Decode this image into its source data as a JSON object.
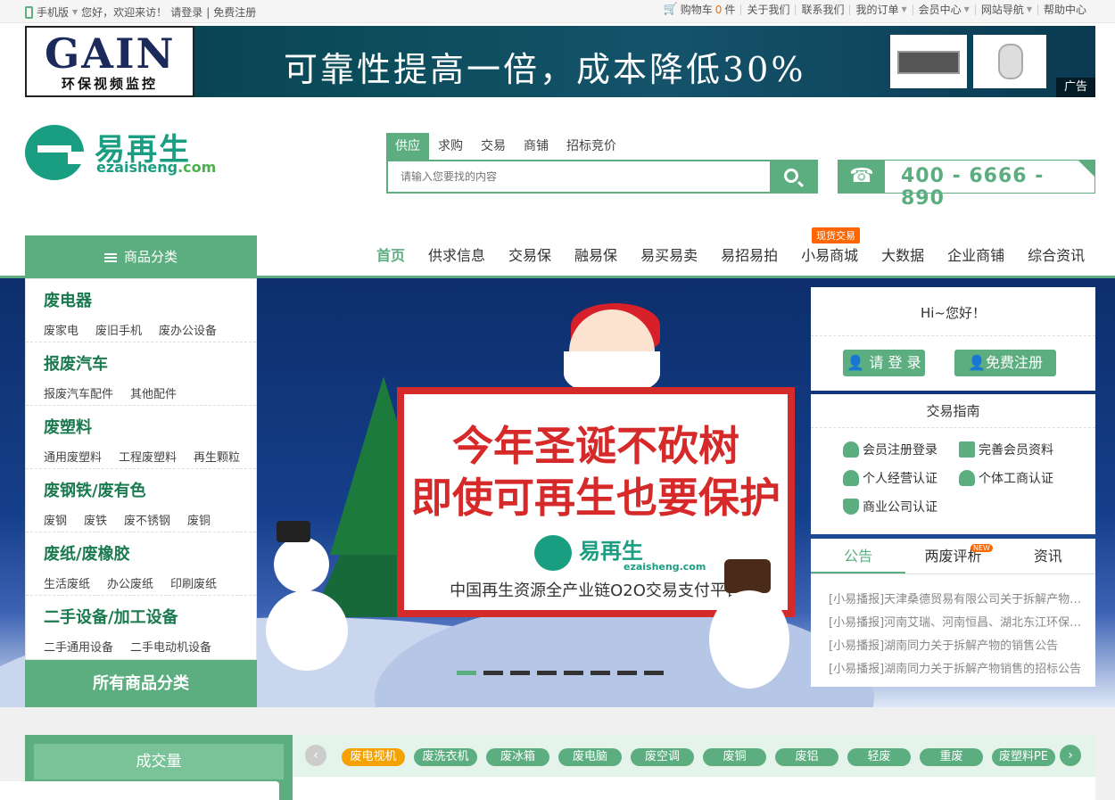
{
  "topbar": {
    "mobile": "手机版",
    "greeting": "您好，欢迎来访！",
    "login": "请登录",
    "divider": "|",
    "register": "免费注册",
    "cart_label": "购物车",
    "cart_count": "0",
    "cart_unit": "件",
    "links": [
      "关于我们",
      "联系我们",
      "我的订单",
      "会员中心",
      "网站导航",
      "帮助中心"
    ]
  },
  "ad": {
    "logo_text": "GAIN",
    "logo_sub": "环保视频监控",
    "slogan": "可靠性提高一倍，成本降低30%",
    "tag": "广告"
  },
  "brand": {
    "cn": "易再生",
    "en_main": "ezaisheng",
    "en_tld": ".com"
  },
  "search": {
    "tabs": [
      "供应",
      "求购",
      "交易",
      "商铺",
      "招标竞价"
    ],
    "active_tab": "供应",
    "placeholder": "请输入您要找的内容"
  },
  "hotline": {
    "number": "400 - 6666 - 890"
  },
  "nav": {
    "category_label": "商品分类",
    "items": [
      "首页",
      "供求信息",
      "交易保",
      "融易保",
      "易买易卖",
      "易招易拍",
      "小易商城",
      "大数据",
      "企业商铺",
      "综合资讯"
    ],
    "active": "首页",
    "badge": "现货交易"
  },
  "categories": [
    {
      "title": "废电器",
      "subs": [
        "废家电",
        "废旧手机",
        "废办公设备"
      ]
    },
    {
      "title": "报废汽车",
      "subs": [
        "报废汽车配件",
        "其他配件"
      ]
    },
    {
      "title": "废塑料",
      "subs": [
        "通用废塑料",
        "工程废塑料",
        "再生颗粒"
      ]
    },
    {
      "title": "废钢铁/废有色",
      "subs": [
        "废钢",
        "废铁",
        "废不锈钢",
        "废铜"
      ]
    },
    {
      "title": "废纸/废橡胶",
      "subs": [
        "生活废纸",
        "办公废纸",
        "印刷废纸"
      ]
    },
    {
      "title": "二手设备/加工设备",
      "subs": [
        "二手通用设备",
        "二手电动机设备"
      ]
    }
  ],
  "all_categories": "所有商品分类",
  "hero": {
    "line1": "今年圣诞不砍树",
    "line2": "即使可再生也要保护",
    "logo_cn": "易再生",
    "logo_en": "ezaisheng.com",
    "tagline": "中国再生资源全产业链O2O交易支付平台",
    "slides": 8,
    "active_slide": 1
  },
  "user_panel": {
    "hello": "Hi~您好！",
    "login_btn": "请 登 录",
    "register_btn": "免费注册"
  },
  "guide": {
    "title": "交易指南",
    "items": [
      "会员注册登录",
      "完善会员资料",
      "个人经营认证",
      "个体工商认证",
      "商业公司认证"
    ]
  },
  "news_panel": {
    "tabs": [
      "公告",
      "两废评析",
      "资讯"
    ],
    "active_tab": "公告",
    "new_badge": "NEW",
    "items": [
      "[小易播报]天津桑德贸易有限公司关于拆解产物的销售公告",
      "[小易播报]河南艾瑞、河南恒昌、湖北东江环保关于拆解产物的销售公告",
      "[小易播报]湖南同力关于拆解产物的销售公告",
      "[小易播报]湖南同力关于拆解产物销售的招标公告"
    ]
  },
  "volume": {
    "label": "成交量"
  },
  "tags": [
    "废电视机",
    "废洗衣机",
    "废冰箱",
    "废电脑",
    "废空调",
    "废铜",
    "废铝",
    "轻废",
    "重废",
    "废塑料PE"
  ],
  "colors": {
    "brand_green": "#5cae80",
    "logo_green": "#1a9e82",
    "accent_orange": "#ff6600",
    "hot_tag": "#f5a100"
  }
}
